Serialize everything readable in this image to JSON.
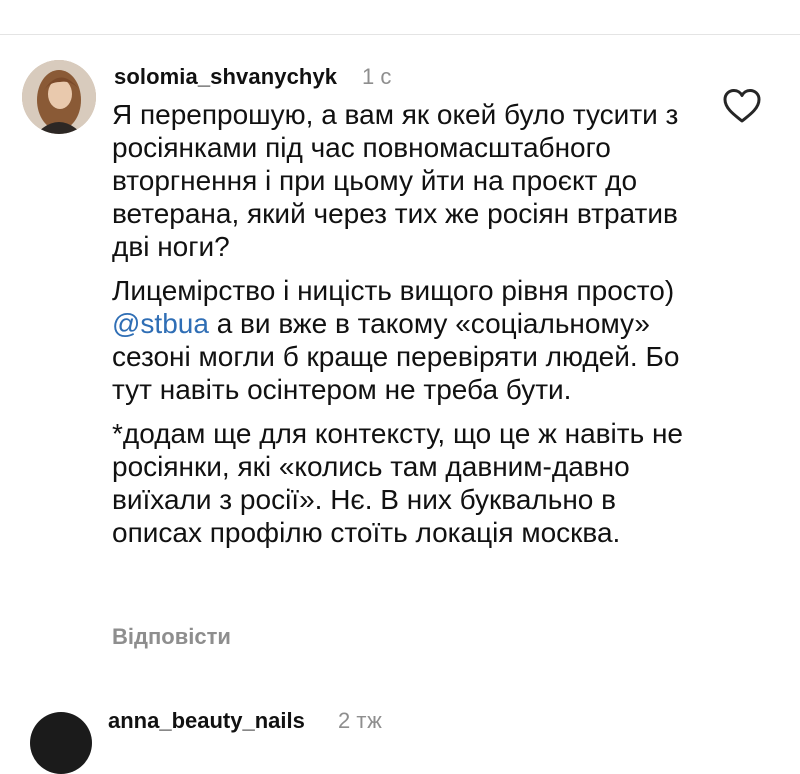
{
  "comment": {
    "username": "solomia_shvanychyk",
    "time": "1 с",
    "paragraphs": [
      "Я перепрошую, а вам як окей було тусити з росіянками під час повномасштабного вторгнення і при цьому йти на проєкт до ветерана, який через тих же росіян втратив дві ноги?",
      null,
      "*додам ще для контексту, що це ж навіть не росіянки, які «колись там давним-давно виїхали з росії». Нє. В них буквально в описах профілю стоїть локація москва."
    ],
    "p2_before": "Лицемірство і ницість вищого рівня просто) ",
    "mention": "@stbua",
    "p2_after": " а ви вже в такому «соціальному» сезоні могли б краще перевіряти людей. Бо тут навіть осінтером не треба бути.",
    "reply_label": "Відповісти",
    "like_icon": "heart-outline-icon"
  },
  "next_comment": {
    "username": "anna_beauty_nails",
    "time": "2 тж"
  }
}
